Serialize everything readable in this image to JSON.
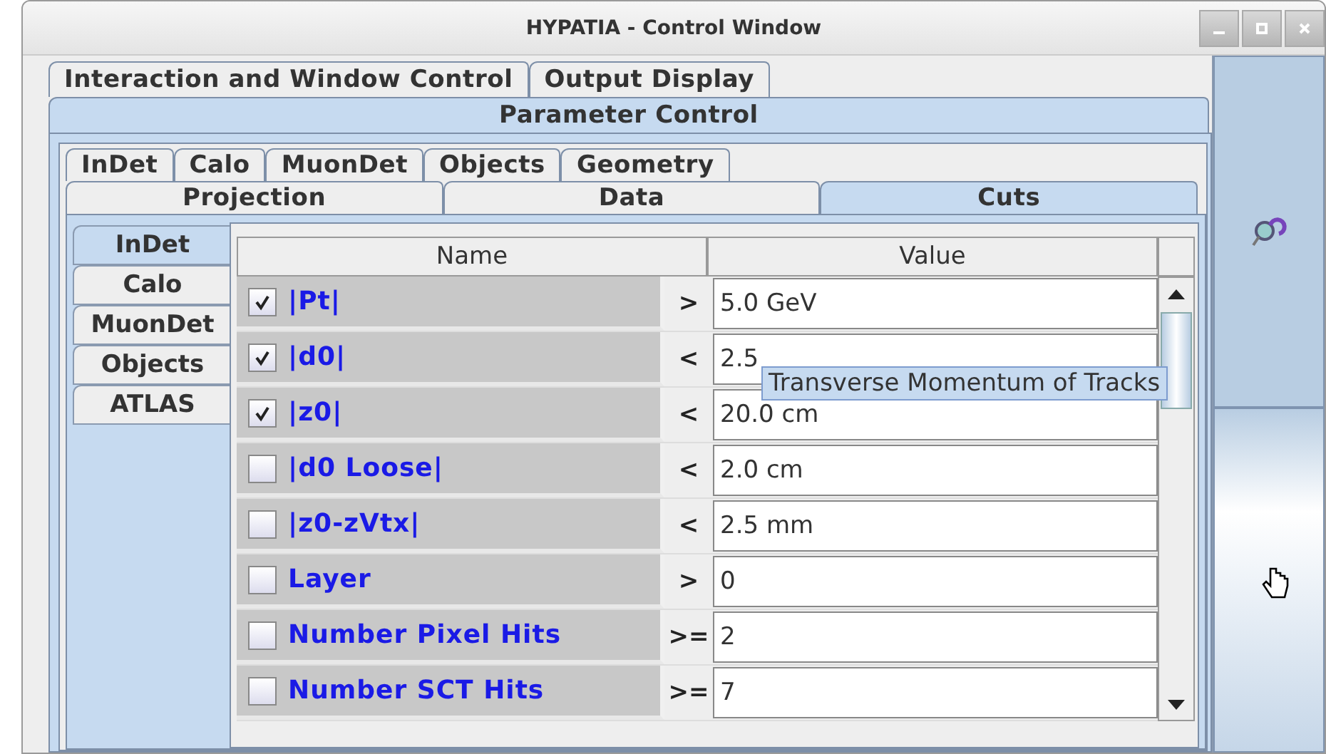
{
  "window": {
    "title": "HYPATIA - Control Window"
  },
  "main_tabs": [
    {
      "label": "Interaction and Window Control",
      "selected": false
    },
    {
      "label": "Output Display",
      "selected": false
    }
  ],
  "parameter_tab": {
    "label": "Parameter Control",
    "selected": true
  },
  "sub_tabs": [
    {
      "label": "InDet",
      "selected": false
    },
    {
      "label": "Calo",
      "selected": false
    },
    {
      "label": "MuonDet",
      "selected": false
    },
    {
      "label": "Objects",
      "selected": false
    },
    {
      "label": "Geometry",
      "selected": false
    }
  ],
  "sub_tabs_2": [
    {
      "label": "Projection",
      "selected": false
    },
    {
      "label": "Data",
      "selected": false
    },
    {
      "label": "Cuts",
      "selected": true
    }
  ],
  "side_tabs": [
    {
      "label": "InDet",
      "selected": true
    },
    {
      "label": "Calo",
      "selected": false
    },
    {
      "label": "MuonDet",
      "selected": false
    },
    {
      "label": "Objects",
      "selected": false
    },
    {
      "label": "ATLAS",
      "selected": false
    }
  ],
  "table": {
    "columns": [
      "Name",
      "Value"
    ],
    "rows": [
      {
        "name": "|Pt|",
        "checked": true,
        "op": ">",
        "value": "5.0 GeV"
      },
      {
        "name": "|d0|",
        "checked": true,
        "op": "<",
        "value": "2.5"
      },
      {
        "name": "|z0|",
        "checked": true,
        "op": "<",
        "value": "20.0 cm"
      },
      {
        "name": "|d0 Loose|",
        "checked": false,
        "op": "<",
        "value": "2.0 cm"
      },
      {
        "name": "|z0-zVtx|",
        "checked": false,
        "op": "<",
        "value": "2.5 mm"
      },
      {
        "name": "Layer",
        "checked": false,
        "op": ">",
        "value": "0"
      },
      {
        "name": "Number Pixel Hits",
        "checked": false,
        "op": ">=",
        "value": "2"
      },
      {
        "name": "Number SCT Hits",
        "checked": false,
        "op": ">=",
        "value": "7"
      }
    ]
  },
  "tooltip": "Transverse Momentum of Tracks"
}
